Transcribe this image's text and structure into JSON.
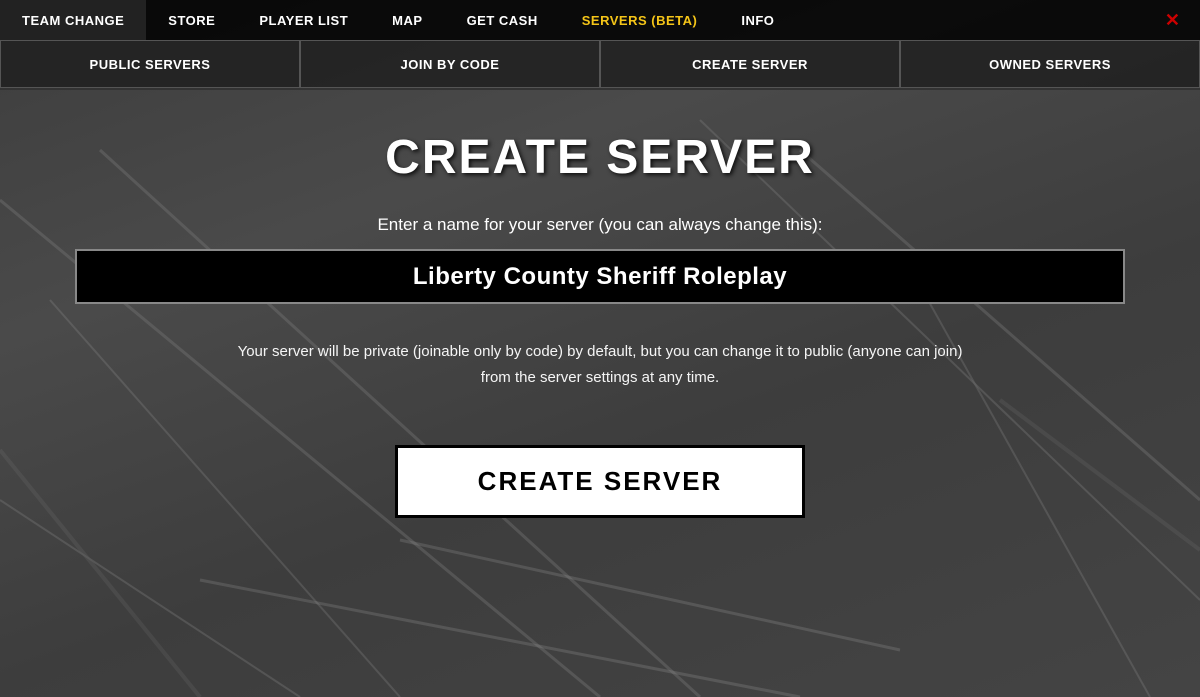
{
  "nav": {
    "items": [
      {
        "label": "TEAM CHANGE",
        "active": false
      },
      {
        "label": "STORE",
        "active": false
      },
      {
        "label": "PLAYER LIST",
        "active": false
      },
      {
        "label": "MAP",
        "active": false
      },
      {
        "label": "GET CASH",
        "active": false
      },
      {
        "label": "SERVERS (BETA)",
        "active": true
      },
      {
        "label": "INFO",
        "active": false
      }
    ],
    "close_label": "✕"
  },
  "tabs": [
    {
      "label": "PUBLIC SERVERS"
    },
    {
      "label": "JOIN BY CODE"
    },
    {
      "label": "CREATE SERVER"
    },
    {
      "label": "OWNED SERVERS"
    }
  ],
  "page": {
    "title": "CREATE SERVER",
    "input_label": "Enter a name for your server (you can always change this):",
    "input_value": "Liberty County Sheriff Roleplay",
    "privacy_note": "Your server will be private (joinable only by code) by default, but you can change it to public (anyone can join) from the server settings at any time.",
    "create_button_label": "CREATE SERVER"
  },
  "colors": {
    "active_nav": "#f5c518",
    "close_btn": "#cc0000"
  }
}
